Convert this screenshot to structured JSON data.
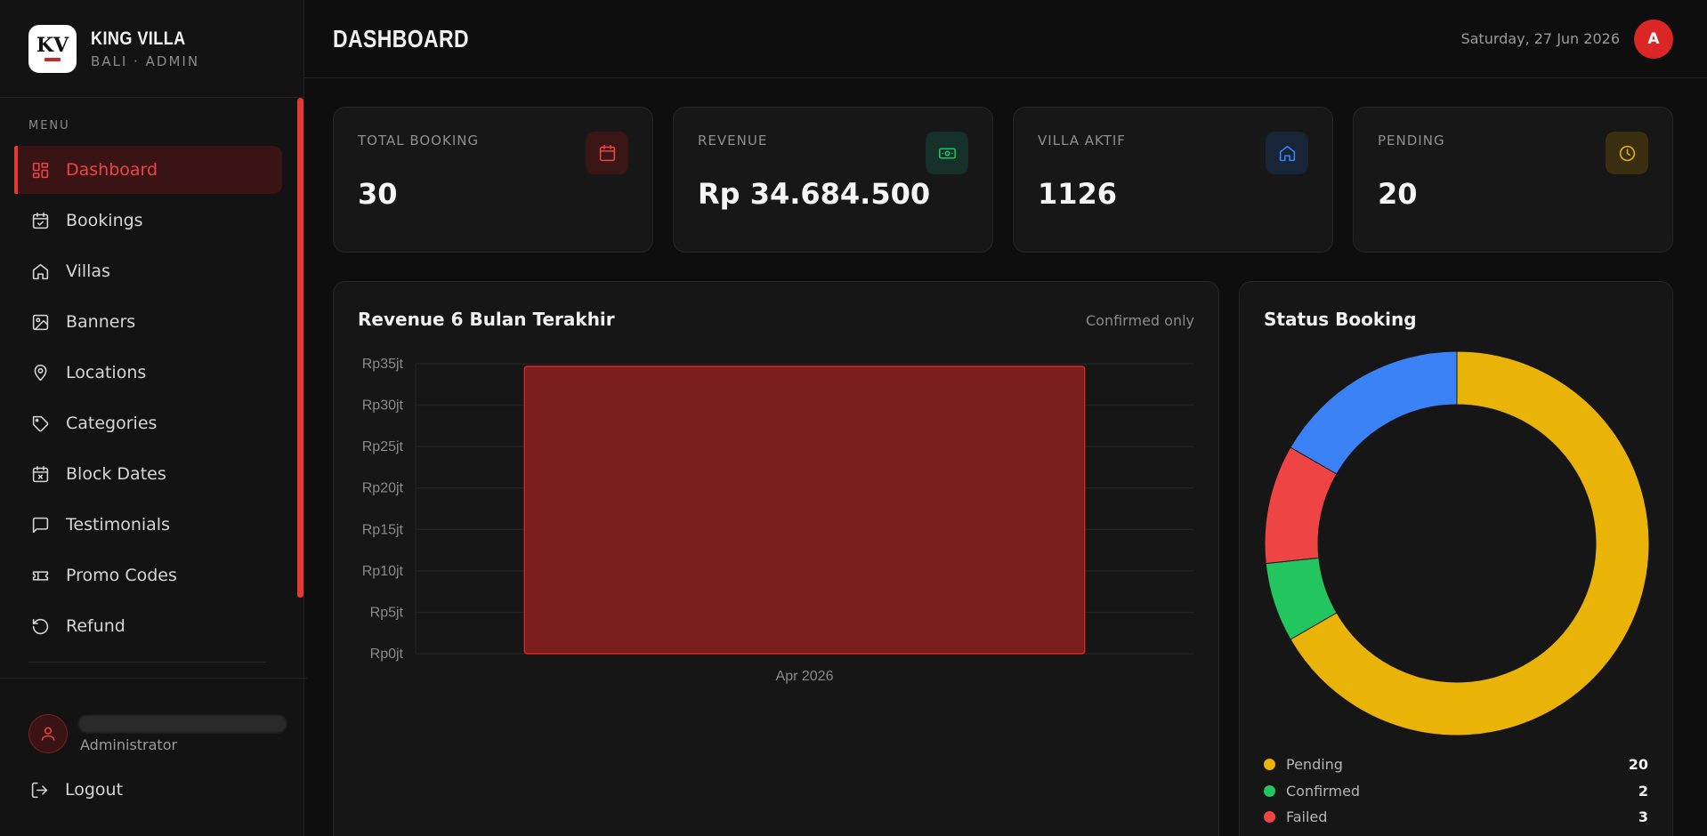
{
  "brand": {
    "name": "KING VILLA",
    "subtitle": "BALI · ADMIN",
    "logo_text": "KV"
  },
  "sidebar": {
    "menu_label": "MENU",
    "items": [
      {
        "label": "Dashboard",
        "icon": "dashboard-icon",
        "active": true
      },
      {
        "label": "Bookings",
        "icon": "calendar-check-icon"
      },
      {
        "label": "Villas",
        "icon": "home-icon"
      },
      {
        "label": "Banners",
        "icon": "image-icon"
      },
      {
        "label": "Locations",
        "icon": "map-pin-icon"
      },
      {
        "label": "Categories",
        "icon": "tag-icon"
      },
      {
        "label": "Block Dates",
        "icon": "calendar-x-icon"
      },
      {
        "label": "Testimonials",
        "icon": "message-icon"
      },
      {
        "label": "Promo Codes",
        "icon": "ticket-icon"
      },
      {
        "label": "Refund",
        "icon": "refresh-icon"
      }
    ],
    "user_role": "Administrator",
    "logout_label": "Logout"
  },
  "header": {
    "title": "DASHBOARD",
    "date": "Saturday, 27 Jun 2026",
    "avatar_initial": "A"
  },
  "stats": [
    {
      "label": "TOTAL BOOKING",
      "value": "30",
      "icon": "calendar-icon",
      "color": "#ef4444",
      "bg": "#3a1616"
    },
    {
      "label": "REVENUE",
      "value": "Rp 34.684.500",
      "icon": "cash-icon",
      "color": "#22c55e",
      "bg": "#16302a"
    },
    {
      "label": "VILLA AKTIF",
      "value": "1126",
      "icon": "home-icon",
      "color": "#3b82f6",
      "bg": "#172536"
    },
    {
      "label": "PENDING",
      "value": "20",
      "icon": "clock-icon",
      "color": "#eab308",
      "bg": "#3a2e10"
    }
  ],
  "revenue_panel": {
    "title": "Revenue 6 Bulan Terakhir",
    "note": "Confirmed only"
  },
  "status_panel": {
    "title": "Status Booking",
    "legend": [
      {
        "label": "Pending",
        "count": "20"
      },
      {
        "label": "Confirmed",
        "count": "2"
      },
      {
        "label": "Failed",
        "count": "3"
      }
    ]
  },
  "colors": {
    "accent": "#e53935",
    "pending": "#eab308",
    "confirmed": "#22c55e",
    "failed": "#ef4444",
    "cancelled": "#3b82f6",
    "bar_fill": "#7a1d1d"
  },
  "chart_data": [
    {
      "type": "bar",
      "title": "Revenue 6 Bulan Terakhir",
      "categories": [
        "Apr 2026"
      ],
      "values": [
        34684500
      ],
      "ylim": [
        0,
        35000000
      ],
      "yticks": [
        0,
        5000000,
        10000000,
        15000000,
        20000000,
        25000000,
        30000000,
        35000000
      ],
      "ytick_labels": [
        "Rp0jt",
        "Rp5jt",
        "Rp10jt",
        "Rp15jt",
        "Rp20jt",
        "Rp25jt",
        "Rp30jt",
        "Rp35jt"
      ],
      "grid": true
    },
    {
      "type": "pie",
      "title": "Status Booking",
      "donut": true,
      "slices": [
        {
          "label": "Pending",
          "value": 20,
          "color": "#eab308"
        },
        {
          "label": "Confirmed",
          "value": 2,
          "color": "#22c55e"
        },
        {
          "label": "Failed",
          "value": 3,
          "color": "#ef4444"
        },
        {
          "value": 5,
          "color": "#3b82f6"
        }
      ]
    }
  ]
}
